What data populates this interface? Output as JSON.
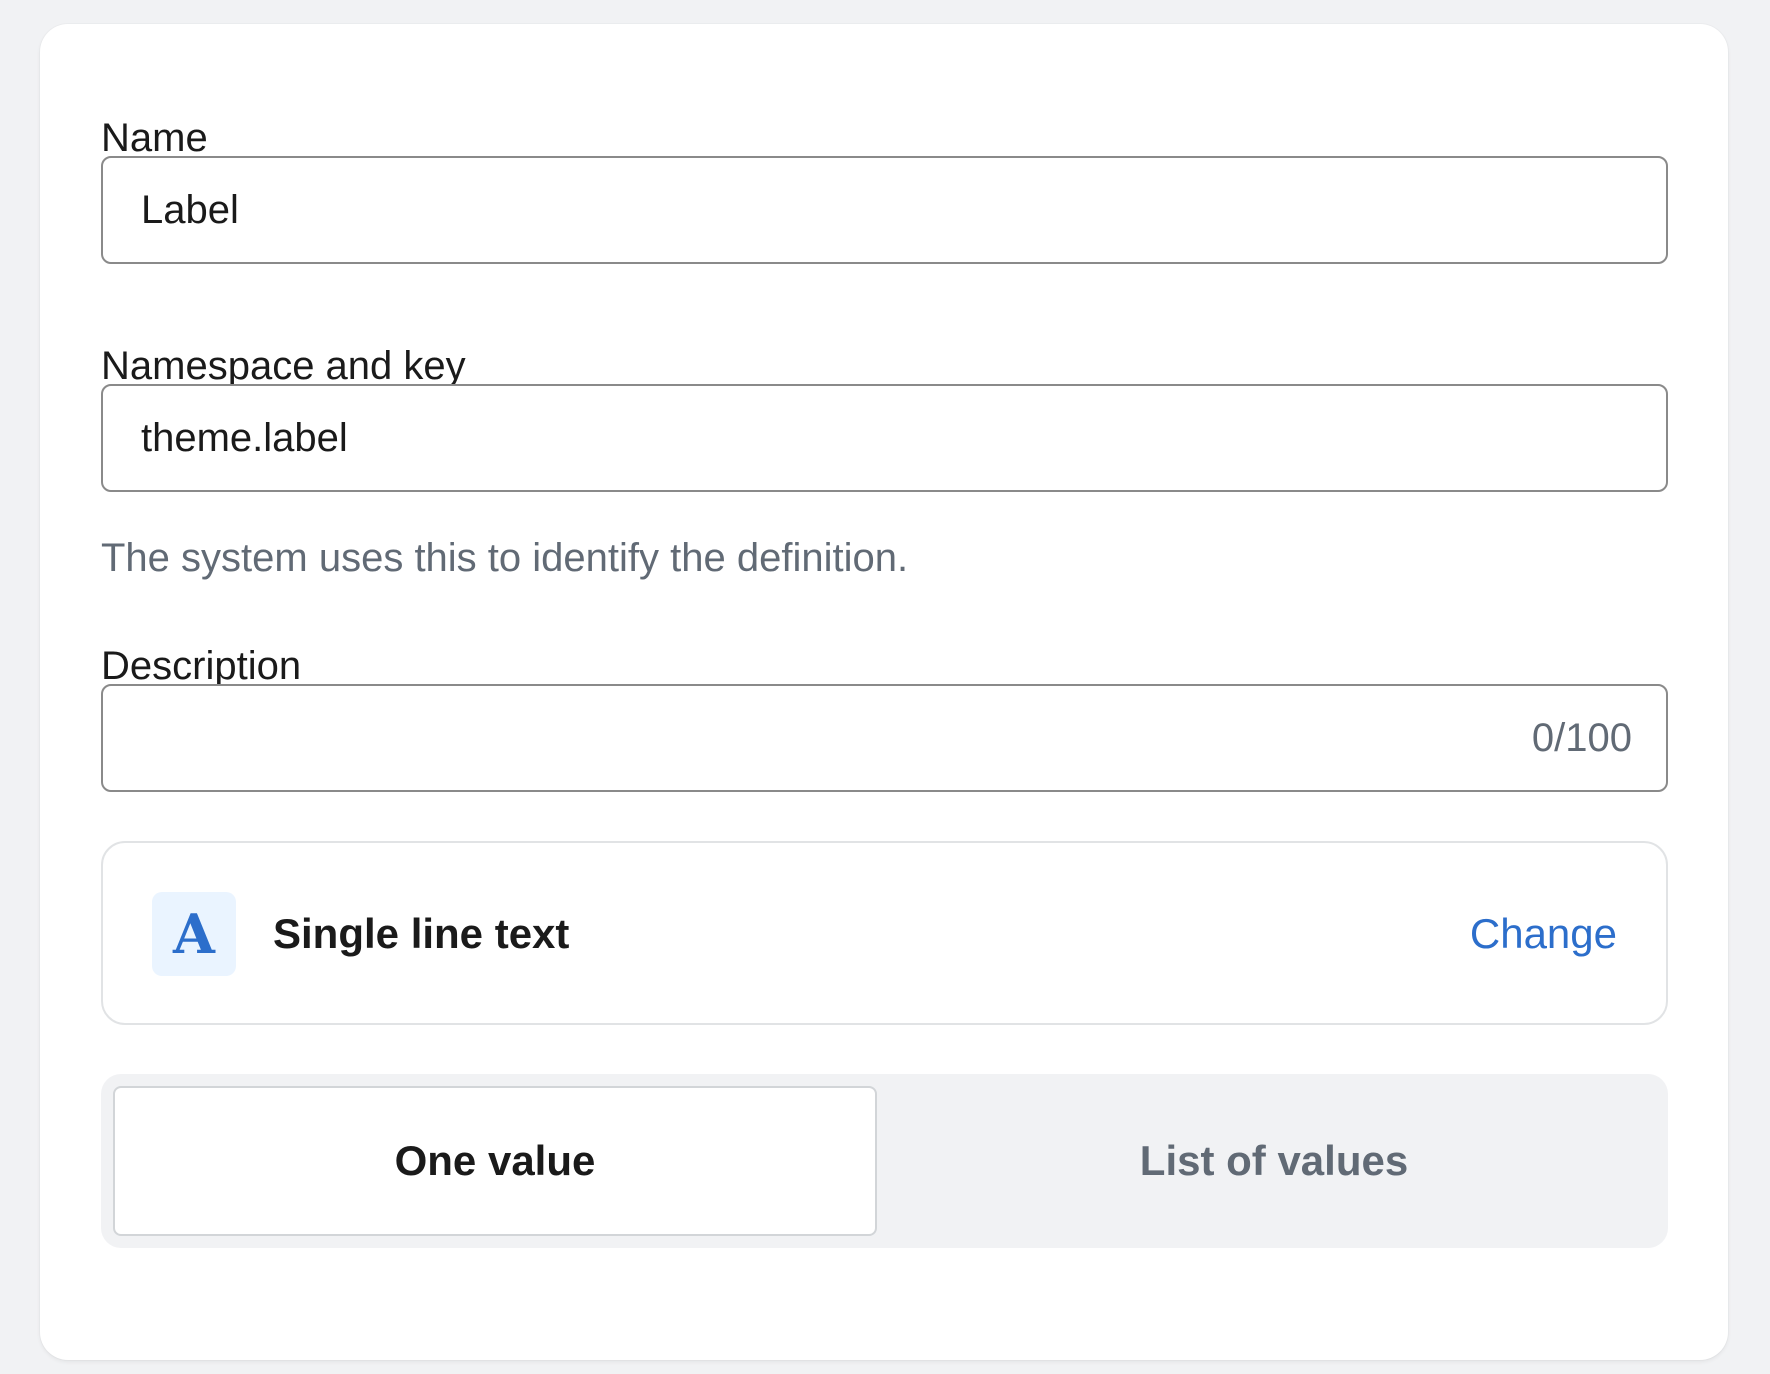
{
  "form": {
    "name": {
      "label": "Name",
      "value": "Label"
    },
    "namespace_key": {
      "label": "Namespace and key",
      "value": "theme.label",
      "help_text": "The system uses this to identify the definition."
    },
    "description": {
      "label": "Description",
      "value": "",
      "counter": "0/100"
    },
    "type": {
      "icon_letter": "A",
      "icon": "text-type-icon",
      "label": "Single line text",
      "change_label": "Change"
    },
    "value_mode": {
      "options": [
        {
          "label": "One value",
          "selected": true
        },
        {
          "label": "List of values",
          "selected": false
        }
      ]
    }
  },
  "colors": {
    "accent": "#2c6ecb",
    "icon_background": "#eaf4ff",
    "subdued_text": "#616a75",
    "background": "#f1f2f4"
  }
}
